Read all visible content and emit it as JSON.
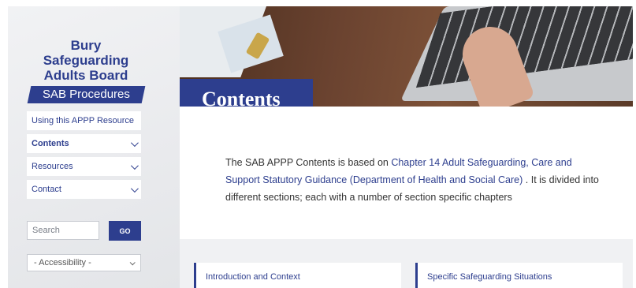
{
  "brand": {
    "line1": "Bury Safeguarding",
    "line2": "Adults Board",
    "band": "SAB Procedures",
    "color": "#2d3e8e"
  },
  "nav": {
    "items": [
      {
        "label": "Using this APPP Resource",
        "has_chevron": false,
        "active": false
      },
      {
        "label": "Contents",
        "has_chevron": true,
        "active": true
      },
      {
        "label": "Resources",
        "has_chevron": true,
        "active": false
      },
      {
        "label": "Contact",
        "has_chevron": true,
        "active": false
      }
    ]
  },
  "search": {
    "placeholder": "Search",
    "button_label": "GO"
  },
  "accessibility": {
    "selected": "- Accessibility -"
  },
  "hero": {
    "title": "Contents"
  },
  "intro": {
    "text_before": "The SAB APPP Contents is based on ",
    "link_text": "Chapter 14 Adult Safeguarding, Care and Support Statutory Guidance (Department of Health and Social Care)",
    "text_after": " . It is divided into different sections; each with a number of section specific chapters"
  },
  "sections": [
    {
      "label": "Introduction and Context"
    },
    {
      "label": "Specific Safeguarding Situations"
    }
  ]
}
